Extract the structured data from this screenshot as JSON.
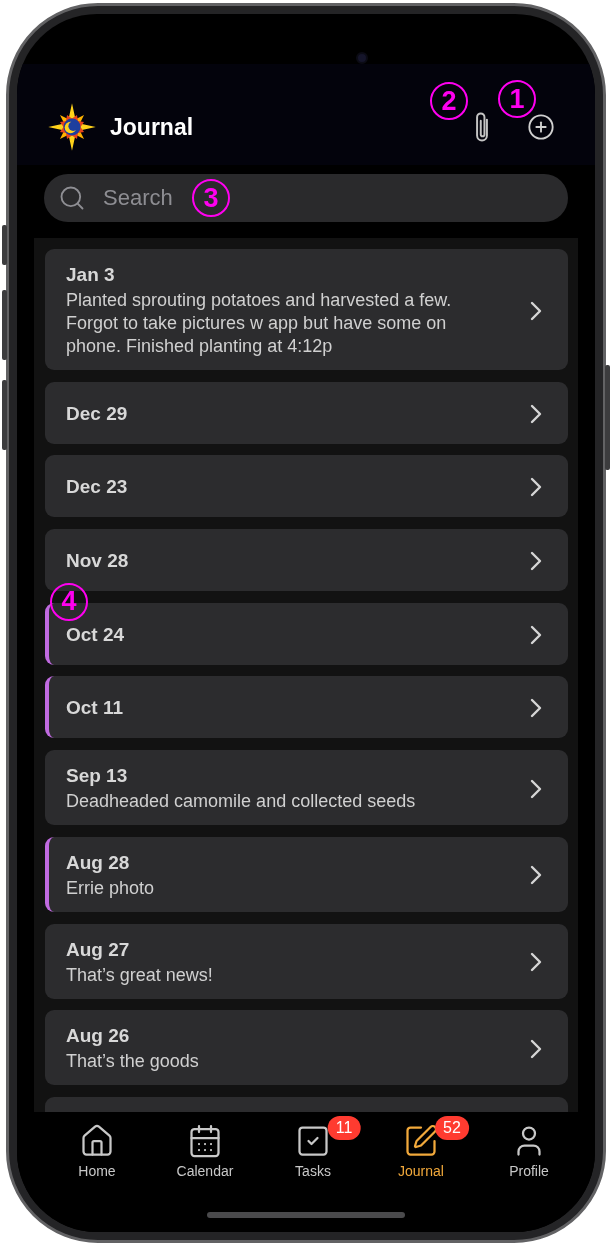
{
  "header": {
    "title": "Journal",
    "actions": [
      {
        "kind": "attach",
        "callout": "2"
      },
      {
        "kind": "add",
        "callout": "1"
      }
    ]
  },
  "search": {
    "placeholder": "Search",
    "callout": "3"
  },
  "entries": [
    {
      "date": "Jan 3",
      "text": "Planted sprouting potatoes and harvested a few. Forgot to take pictures w app but have some on phone. Finished planting at 4:12p",
      "flagged": false
    },
    {
      "date": "Dec 29",
      "flagged": false
    },
    {
      "date": "Dec 23",
      "flagged": false
    },
    {
      "date": "Nov 28",
      "flagged": false
    },
    {
      "date": "Oct 24",
      "flagged": true,
      "callout": "4"
    },
    {
      "date": "Oct 11",
      "flagged": true
    },
    {
      "date": "Sep 13",
      "text": "Deadheaded camomile and collected seeds",
      "flagged": false
    },
    {
      "date": "Aug 28",
      "text": "Errie photo",
      "flagged": true
    },
    {
      "date": "Aug 27",
      "text": "That’s great news!",
      "flagged": false
    },
    {
      "date": "Aug 26",
      "text": "That’s the goods",
      "flagged": false
    }
  ],
  "tabs": [
    {
      "label": "Home",
      "kind": "home",
      "selected": false
    },
    {
      "label": "Calendar",
      "kind": "calendar",
      "selected": false
    },
    {
      "label": "Tasks",
      "kind": "tasks",
      "badge": "11",
      "selected": false
    },
    {
      "label": "Journal",
      "kind": "journal",
      "badge": "52",
      "selected": true
    },
    {
      "label": "Profile",
      "kind": "profile",
      "selected": false
    }
  ]
}
